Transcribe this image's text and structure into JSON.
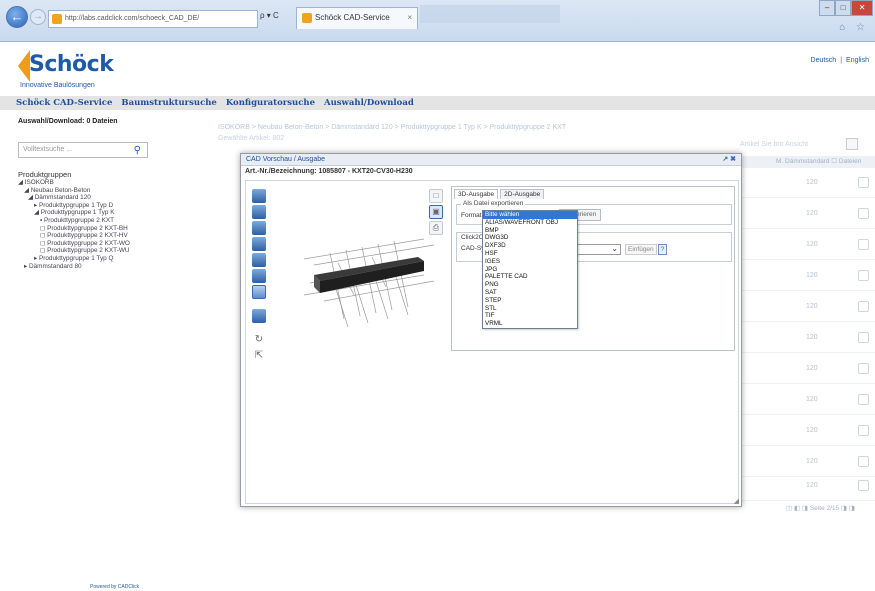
{
  "browser": {
    "url": "http://labs.cadclick.com/schoeck_CAD_DE/",
    "tab_title": "Schöck CAD-Service",
    "addr_tools": "ρ ▾ C",
    "tab_close": "×",
    "back": "←",
    "forward": "→",
    "win": [
      "–",
      "□",
      "✕"
    ],
    "icons": "⌂ ☆"
  },
  "header": {
    "brand": "Schöck",
    "tagline": "Innovative Baulösungen",
    "lang_de": "Deutsch",
    "lang_sep": "|",
    "lang_en": "English"
  },
  "mainnav": [
    "Schöck CAD-Service",
    "Baumstruktursuche",
    "Konfiguratorsuche",
    "Auswahl/Download"
  ],
  "sidebar": {
    "download_count": "Auswahl/Download: 0 Dateien",
    "search_placeholder": "Volltextsuche ...",
    "search_icon": "magnifier-icon",
    "groups_heading": "Produktgruppen",
    "tree": [
      "◢ ISOKORB",
      "  ◢ Neubau Beton-Beton",
      "    ◢ Dämmstandard 120",
      "      ▸ Produkttypgruppe 1 Typ D",
      "      ◢ Produkttypgruppe 1 Typ K",
      "        ▪ Produkttypgruppe 2 KXT",
      "        ◻ Produkttypgruppe 2 KXT-BH",
      "        ◻ Produkttypgruppe 2 KXT-HV",
      "        ◻ Produkttypgruppe 2 KXT-WO",
      "        ◻ Produkttypgruppe 2 KXT-WU",
      "      ▸ Produkttypgruppe 1 Typ Q",
      "  ▸ Dämmstandard 80"
    ]
  },
  "background": {
    "breadcrumb": "ISOKORB > Neubau Beton-Beton > Dämmstandard 120 > Produkttypgruppe 1 Typ K > Produkttypgruppe 2 KXT",
    "selection_label": "Gewählte Artikel: 802",
    "rows_per_page": "Artikel Sie bro Ansicht",
    "table_header": "M. Dämmstandard  ☐ Dateien",
    "row_value": "120",
    "pager": "◫  ◧ ◨ Seite 2/15 ◨ ◨"
  },
  "modal": {
    "title": "CAD Vorschau / Ausgabe",
    "title_controls": "↗ ✖",
    "article": "Art.-Nr./Bezeichnung: 1085807 - KXT20-CV30-H230",
    "tab_3d": "3D-Ausgabe",
    "tab_2d": "2D-Ausgabe",
    "export_legend": "Als Datei exportieren",
    "format_label": "Format",
    "generate_button": "Generieren",
    "click2cad_label": "Click2CAD",
    "cad_system_label": "CAD-Sy",
    "insert_button": "Einfügen",
    "help_button": "?",
    "resize_handle": "◢",
    "side_icons": [
      "□",
      "▣",
      "⎙"
    ],
    "view_tools": [
      "↻",
      "⇱"
    ]
  },
  "format_dropdown": {
    "selected": "Bitte wählen",
    "options": [
      "Bitte wählen",
      "ALIAS/WAVEFRONT OBJ",
      "BMP",
      "DWG3D",
      "DXF3D",
      "HSF",
      "IGES",
      "JPG",
      "PALETTE CAD",
      "PNG",
      "SAT",
      "STEP",
      "STL",
      "TIF",
      "VRML"
    ]
  },
  "footer": {
    "powered": "Powered by CADClick"
  },
  "colors": {
    "brand_blue": "#1e5aa8",
    "brand_orange": "#f29a1c",
    "selection_blue": "#3375d6"
  }
}
